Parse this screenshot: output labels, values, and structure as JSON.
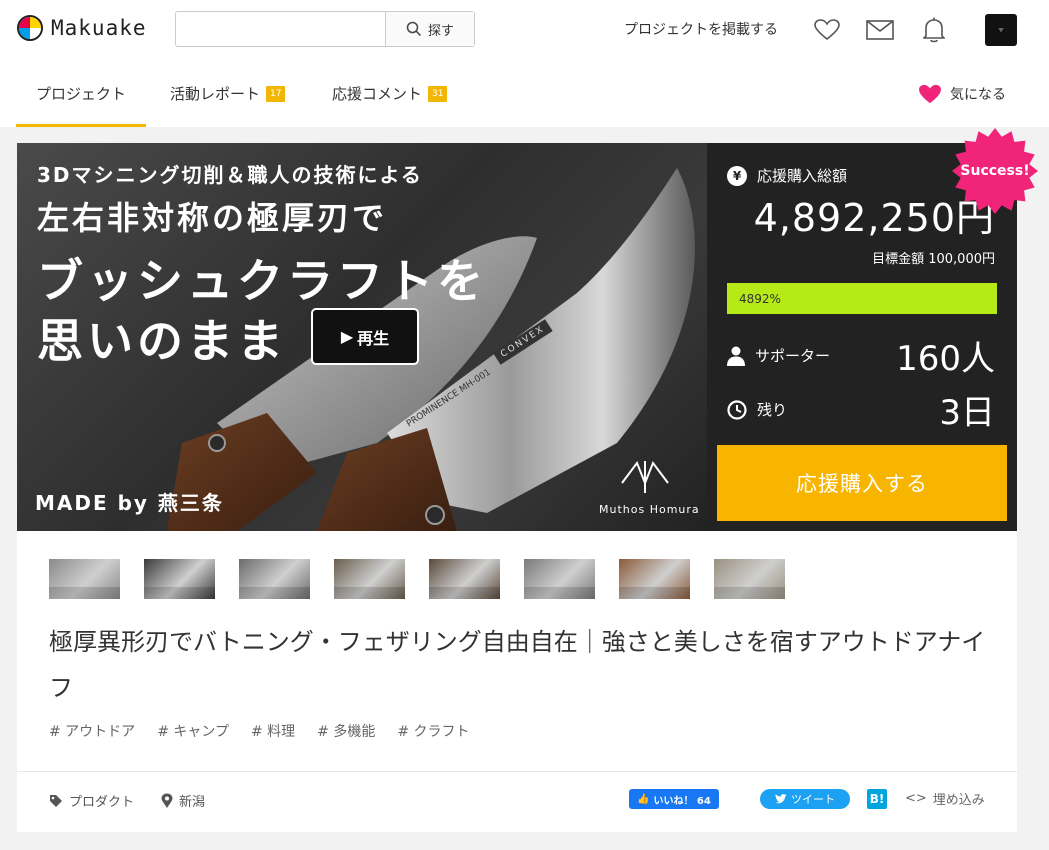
{
  "header": {
    "logo_text": "Makuake",
    "search_placeholder": "",
    "search_button": "探す",
    "post_project": "プロジェクトを掲載する"
  },
  "tabs": [
    {
      "label": "プロジェクト",
      "badge": ""
    },
    {
      "label": "活動レポート",
      "badge": "17"
    },
    {
      "label": "応援コメント",
      "badge": "31"
    }
  ],
  "favorite_label": "気になる",
  "hero": {
    "line1": "3Dマシニング切削＆職人の技術による",
    "line2": "左右非対称の極厚刃で",
    "line3": "ブッシュクラフトを",
    "line4": "思いのまま",
    "made_by": "MADE by 燕三条",
    "brand": "Muthos Homura",
    "blade1_text": "PROMINENCE MH-001",
    "blade2_text": "CONVEX",
    "play_label": "再生"
  },
  "stats": {
    "success_badge": "Success!",
    "total_label": "応援購入総額",
    "total_amount": "4,892,250円",
    "goal": "目標金額 100,000円",
    "progress_text": "4892%",
    "progress_fraction": 1.0,
    "supporters_label": "サポーター",
    "supporters_value": "160人",
    "remaining_label": "残り",
    "remaining_value": "3日",
    "support_button": "応援購入する"
  },
  "thumbnails": [
    {
      "name": "thumb-1",
      "color": "#8a8a8a"
    },
    {
      "name": "thumb-2",
      "color": "#3a3a3a"
    },
    {
      "name": "thumb-3",
      "color": "#6b6b6b"
    },
    {
      "name": "thumb-4",
      "color": "#6a5e4e"
    },
    {
      "name": "thumb-5",
      "color": "#5a4a3a"
    },
    {
      "name": "thumb-6",
      "color": "#7a7a7a"
    },
    {
      "name": "thumb-7",
      "color": "#8a5a3a"
    },
    {
      "name": "thumb-8",
      "color": "#9a9080"
    }
  ],
  "project": {
    "title": "極厚異形刃でバトニング・フェザリング自由自在｜強さと美しさを宿すアウトドアナイフ",
    "tags": [
      "# アウトドア",
      "# キャンプ",
      "# 料理",
      "# 多機能",
      "# クラフト"
    ],
    "category": "プロダクト",
    "location": "新潟"
  },
  "share": {
    "facebook": "いいね！ 64",
    "twitter": "ツイート",
    "hatena": "B!",
    "embed": "埋め込み"
  },
  "colors": {
    "accent": "#f2b705",
    "progress": "#b6ea17",
    "support_button": "#f8b500",
    "success": "#f0257a",
    "heart": "#f0257a"
  }
}
